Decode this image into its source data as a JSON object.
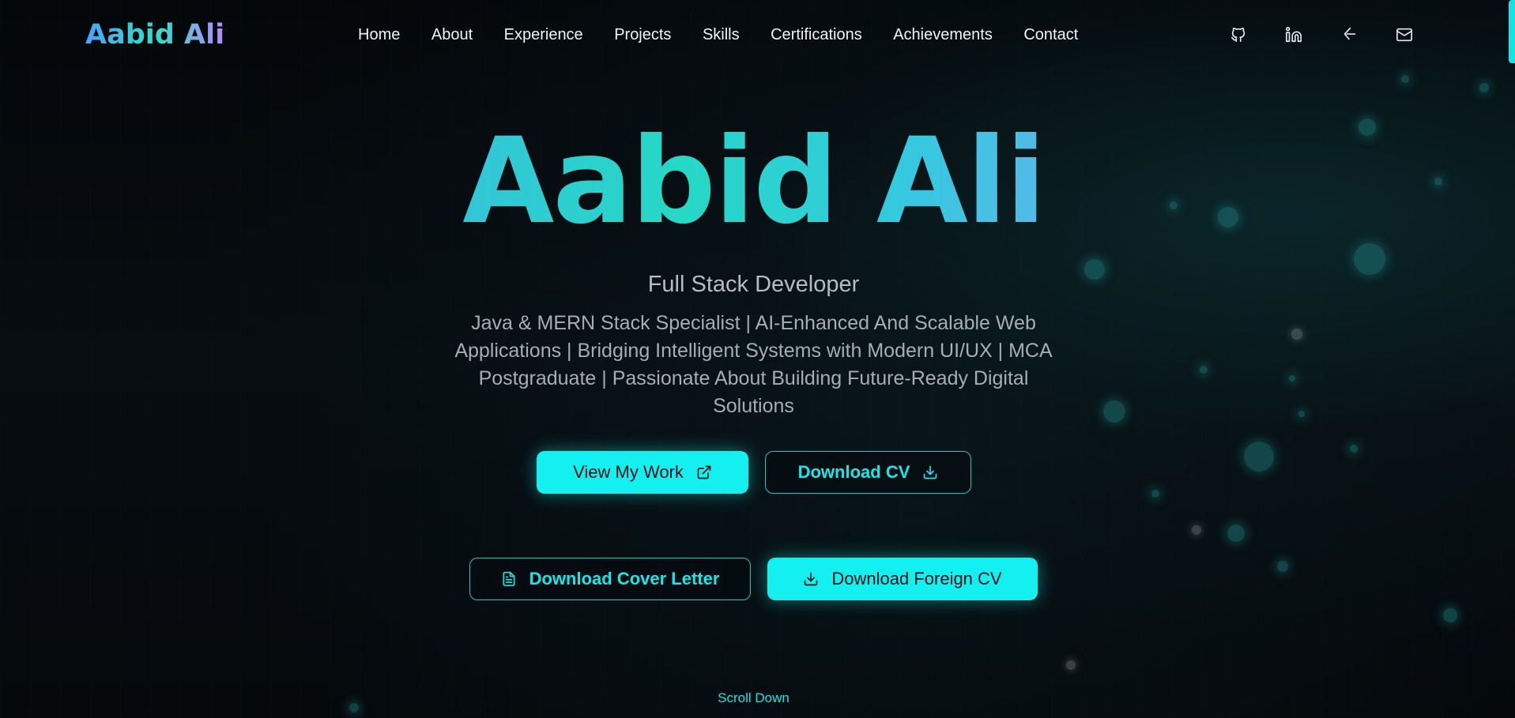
{
  "header": {
    "logo": "Aabid Ali",
    "nav": [
      {
        "label": "Home"
      },
      {
        "label": "About"
      },
      {
        "label": "Experience"
      },
      {
        "label": "Projects"
      },
      {
        "label": "Skills"
      },
      {
        "label": "Certifications"
      },
      {
        "label": "Achievements"
      },
      {
        "label": "Contact"
      }
    ],
    "social_icons": [
      "github-icon",
      "linkedin-icon",
      "leetcode-icon",
      "mail-icon"
    ]
  },
  "hero": {
    "name": "Aabid Ali",
    "role": "Full Stack Developer",
    "description": "Java & MERN Stack Specialist | AI-Enhanced And Scalable Web Applications | Bridging Intelligent Systems with Modern UI/UX | MCA Postgraduate | Passionate About Building Future-Ready Digital Solutions",
    "buttons": {
      "view_work": "View My Work",
      "download_cv": "Download CV",
      "download_cover_letter": "Download Cover Letter",
      "download_foreign_cv": "Download Foreign CV"
    },
    "scroll_hint": "Scroll Down"
  },
  "colors": {
    "accent": "#14f0f0",
    "background": "#05080b",
    "gradient_start": "#4f9dff",
    "gradient_mid": "#26d8c5",
    "gradient_end": "#b98bf8"
  }
}
